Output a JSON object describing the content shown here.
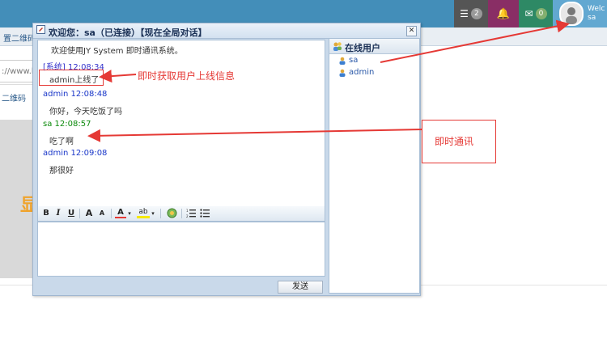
{
  "app": {
    "notif_badges": {
      "tasks": "2",
      "messages": "0"
    },
    "user_area": {
      "welcome": "Welc",
      "username": "sa"
    },
    "subbar_fragment": "置二维码",
    "left_fragments": {
      "url": "://www.b",
      "qr": "二维码",
      "big_char": "显"
    }
  },
  "dialog": {
    "title": "欢迎您：sa（已连接）【现在全局对话】",
    "welcome_msg": "欢迎使用JY System 即时通讯系统。",
    "messages": [
      {
        "header": "[系统] 12:08:34",
        "body": "admin上线了",
        "color": "#3333cc"
      },
      {
        "header": "admin 12:08:48",
        "body": "你好，今天吃饭了吗",
        "color": "#1a37c9"
      },
      {
        "header": "sa 12:08:57",
        "body": "吃了啊",
        "color": "#0b8a0b"
      },
      {
        "header": "admin 12:09:08",
        "body": "那很好",
        "color": "#1a37c9"
      }
    ],
    "toolbar": {
      "bold": "B",
      "italic": "I",
      "underline": "U",
      "grow": "A",
      "shrink": "A",
      "font_color": "A",
      "highlight": "ab"
    },
    "send_label": "发送",
    "online_users": {
      "header": "在线用户",
      "users": [
        "sa",
        "admin"
      ]
    }
  },
  "annotations": {
    "user_online_info": "即时获取用户上线信息",
    "instant_messaging": "即时通讯"
  },
  "colors": {
    "topbar": "#438eb9",
    "annotation": "#e53935"
  }
}
